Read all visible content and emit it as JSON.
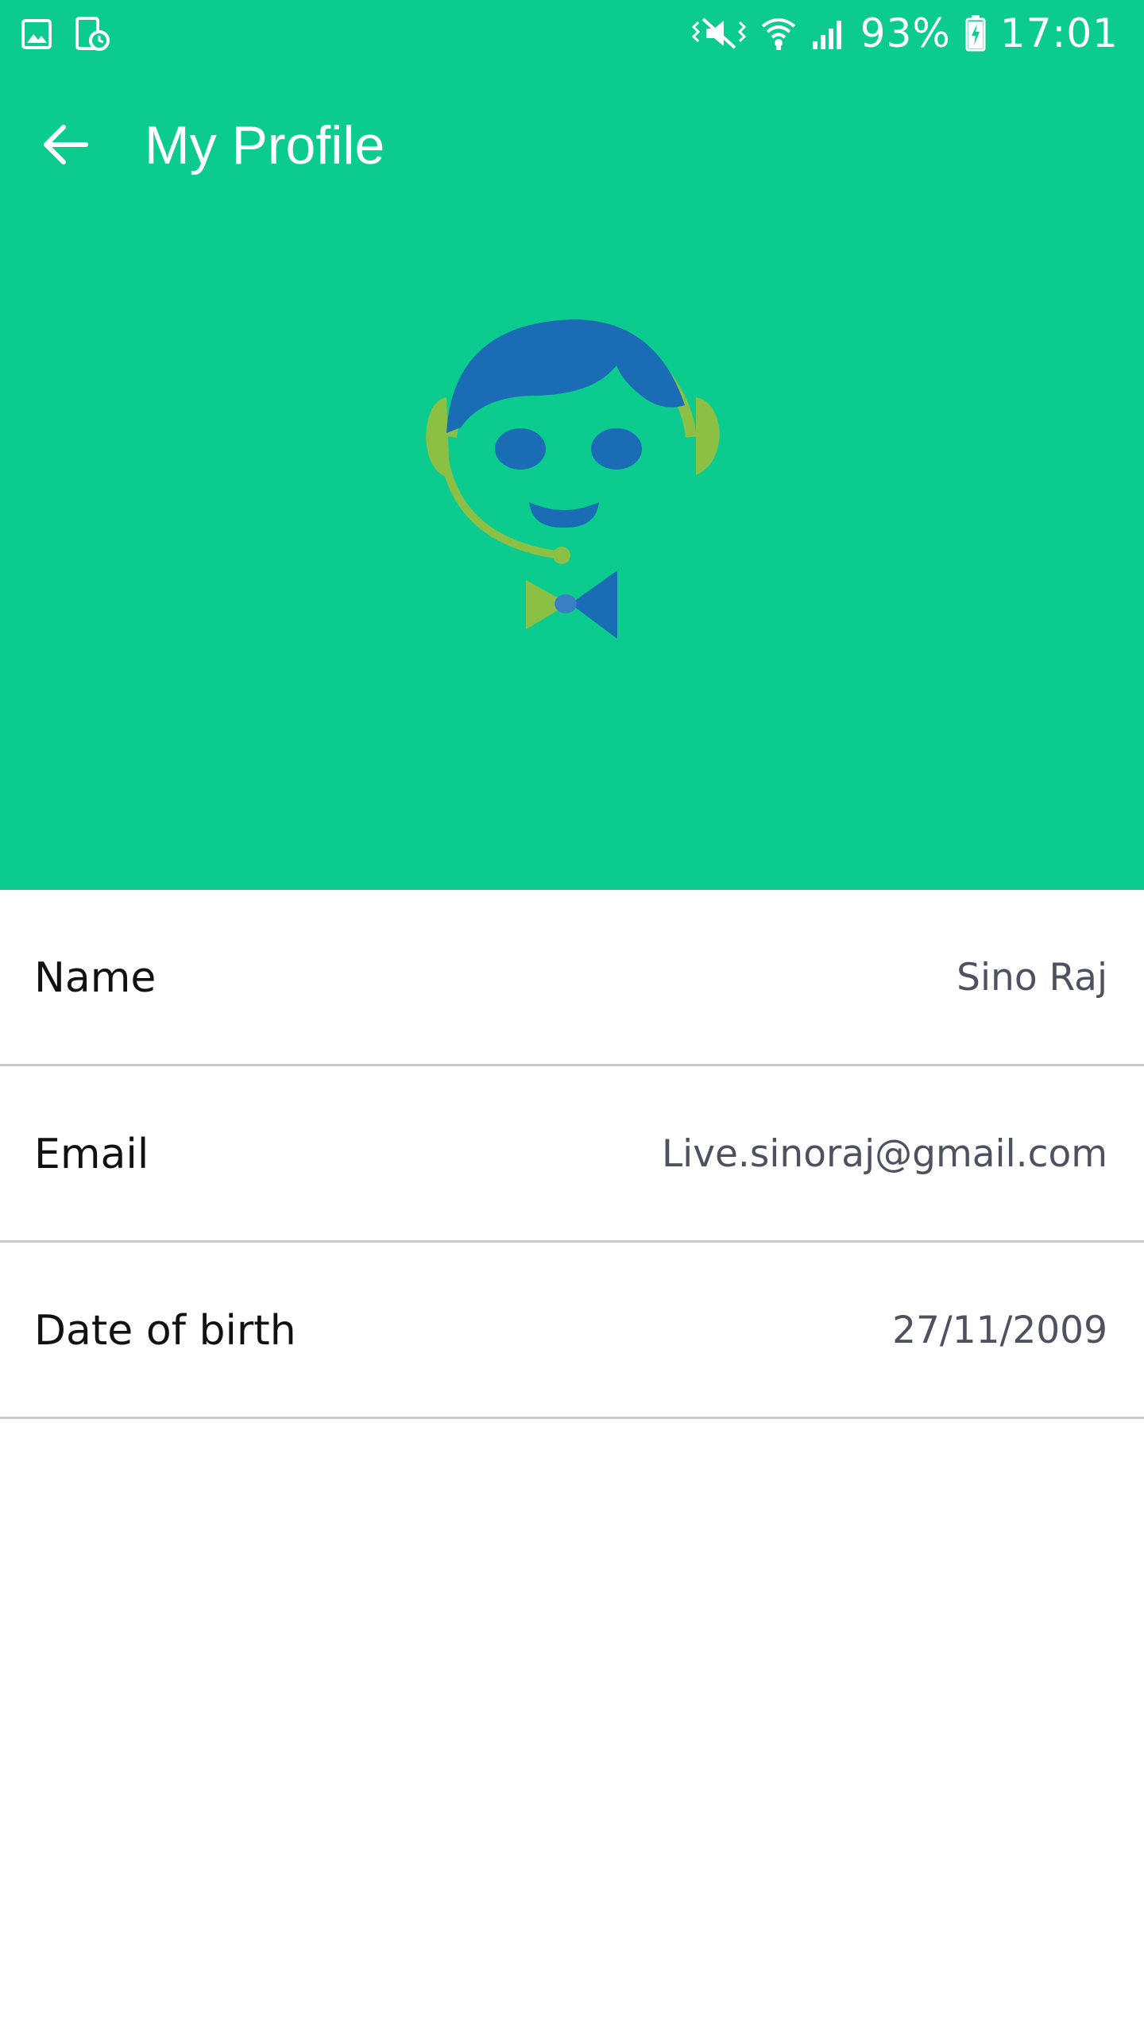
{
  "colors": {
    "header_background": "#0ccb8f",
    "divider": "#c9c9c9",
    "label_text": "#111111",
    "value_text": "#4d5160"
  },
  "status_bar": {
    "left_icons": [
      "gallery-notification-icon",
      "screenshot-notification-icon"
    ],
    "right_icons": [
      "mute-vibrate-icon",
      "wifi-icon",
      "cellular-signal-icon",
      "battery-charging-icon"
    ],
    "battery": "93%",
    "time": "17:01"
  },
  "toolbar": {
    "back_icon": "arrow-left-icon",
    "title": "My Profile"
  },
  "avatar": {
    "icon": "support-agent-avatar-icon"
  },
  "profile": {
    "rows": [
      {
        "label": "Name",
        "value": "Sino Raj"
      },
      {
        "label": "Email",
        "value": "Live.sinoraj@gmail.com"
      },
      {
        "label": "Date of birth",
        "value": "27/11/2009"
      }
    ]
  }
}
